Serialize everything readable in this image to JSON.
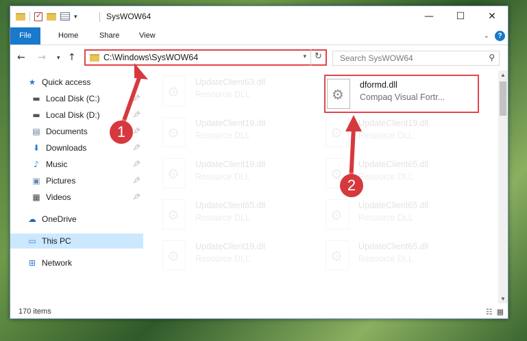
{
  "window": {
    "title": "SysWOW64",
    "controls": {
      "minimize": "—",
      "maximize": "☐",
      "close": "✕"
    }
  },
  "ribbon": {
    "tabs": [
      "File",
      "Home",
      "Share",
      "View"
    ],
    "expand_icon": "chevron-down-icon",
    "help_label": "?"
  },
  "address_bar": {
    "path": "C:\\Windows\\SysWOW64",
    "search_placeholder": "Search SysWOW64"
  },
  "nav_pane": {
    "items": [
      {
        "label": "Quick access",
        "icon": "star-icon",
        "glyph": "★",
        "color": "#2c7cd6"
      },
      {
        "label": "Local Disk (C:)",
        "icon": "drive-icon",
        "glyph": "▬",
        "color": "#555555",
        "pinned": true
      },
      {
        "label": "Local Disk (D:)",
        "icon": "drive-icon",
        "glyph": "▬",
        "color": "#555555",
        "pinned": true
      },
      {
        "label": "Documents",
        "icon": "documents-icon",
        "glyph": "▤",
        "color": "#6a7a8a",
        "pinned": true
      },
      {
        "label": "Downloads",
        "icon": "download-icon",
        "glyph": "⬇",
        "color": "#2c7cd6",
        "pinned": true
      },
      {
        "label": "Music",
        "icon": "music-icon",
        "glyph": "♪",
        "color": "#2c7cd6",
        "pinned": true
      },
      {
        "label": "Pictures",
        "icon": "pictures-icon",
        "glyph": "▣",
        "color": "#6a8aa8",
        "pinned": true
      },
      {
        "label": "Videos",
        "icon": "videos-icon",
        "glyph": "▦",
        "color": "#444444",
        "pinned": true
      },
      {
        "label": "OneDrive",
        "icon": "cloud-icon",
        "glyph": "☁",
        "color": "#1e64b4"
      },
      {
        "label": "This PC",
        "icon": "computer-icon",
        "glyph": "▭",
        "color": "#3a80c8",
        "selected": true
      },
      {
        "label": "Network",
        "icon": "network-icon",
        "glyph": "⊞",
        "color": "#2c7cd6"
      }
    ]
  },
  "files": {
    "highlighted": {
      "name": "dformd.dll",
      "type": "Compaq Visual Fortr..."
    },
    "faded": [
      {
        "name": "UpdateClient63.dll",
        "type": "Resource DLL"
      },
      {
        "name": "UpdateClient19.dll",
        "type": "Resource DLL"
      },
      {
        "name": "UpdateClient19.dll",
        "type": "Resource DLL"
      },
      {
        "name": "UpdateClient19.dll",
        "type": "Resource DLL"
      },
      {
        "name": "UpdateClient65.dll",
        "type": "Resource DLL"
      },
      {
        "name": "UpdateClient65.dll",
        "type": "Resource DLL"
      },
      {
        "name": "UpdateClient65.dll",
        "type": "Resource DLL"
      },
      {
        "name": "UpdateClient19.dll",
        "type": "Resource DLL"
      },
      {
        "name": "UpdateClient65.dll",
        "type": "Resource DLL"
      }
    ]
  },
  "status": {
    "item_count": "170 items"
  },
  "annotations": {
    "step1": "1",
    "step2": "2",
    "color": "#d6393d"
  }
}
